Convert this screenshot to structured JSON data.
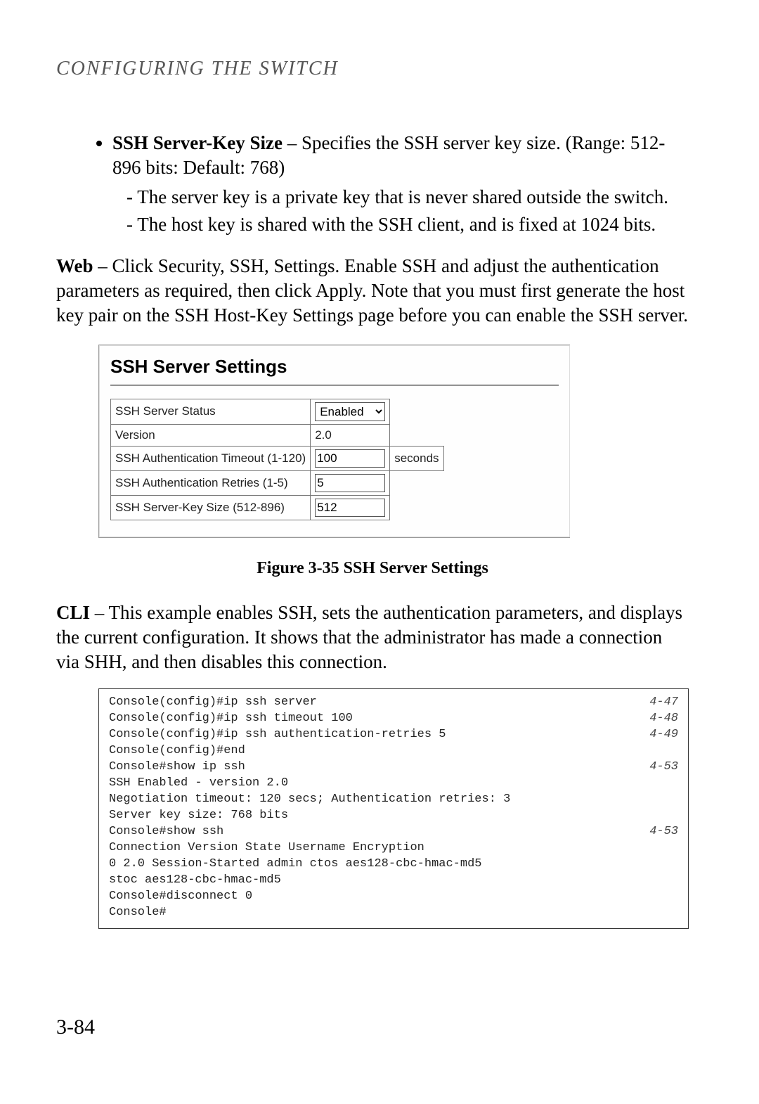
{
  "header": "CONFIGURING THE SWITCH",
  "page_num": "3-84",
  "bullet": {
    "label": "SSH Server-Key Size",
    "desc": " – Specifies the SSH server key size. (Range: 512-896 bits: Default: 768)",
    "sub1": "- The server key is a private key that is never shared outside the switch.",
    "sub2": "- The host key is shared with the SSH client, and is fixed at 1024 bits."
  },
  "web_para_b": "Web",
  "web_para": " – Click Security, SSH, Settings. Enable SSH and adjust the authentication parameters as required, then click Apply. Note that you must first generate the host key pair on the SSH Host-Key Settings page before you can enable the SSH server.",
  "ui": {
    "title": "SSH Server Settings",
    "rows": {
      "status_label": "SSH Server Status",
      "status_value": "Enabled",
      "version_label": "Version",
      "version_value": "2.0",
      "timeout_label": "SSH Authentication Timeout (1-120)",
      "timeout_value": "100",
      "timeout_unit": "seconds",
      "retries_label": "SSH Authentication Retries (1-5)",
      "retries_value": "5",
      "keysize_label": "SSH Server-Key Size (512-896)",
      "keysize_value": "512"
    }
  },
  "fig_caption": "Figure 3-35  SSH Server Settings",
  "cli_para_b": "CLI",
  "cli_para": " – This example enables SSH, sets the authentication parameters, and displays the current configuration. It shows that the administrator has made a connection via SHH, and then disables this connection.",
  "cli": {
    "l1": "Console(config)#ip ssh server",
    "r1": "4-47",
    "l2": "Console(config)#ip ssh timeout 100",
    "r2": "4-48",
    "l3": "Console(config)#ip ssh authentication-retries 5",
    "r3": "4-49",
    "l4": "Console(config)#end",
    "l5": "Console#show ip ssh",
    "r5": "4-53",
    "l6": "SSH Enabled - version 2.0",
    "l7": "Negotiation timeout: 120 secs; Authentication retries: 3",
    "l8": "Server key size: 768 bits",
    "l9": "Console#show ssh",
    "r9": "4-53",
    "l10": "Connection  Version  State            Username  Encryption",
    "l11": "0           2.0      Session-Started  admin     ctos aes128-cbc-hmac-md5",
    "l12": "                                                stoc aes128-cbc-hmac-md5",
    "l13": "Console#disconnect 0",
    "l14": "Console#"
  }
}
